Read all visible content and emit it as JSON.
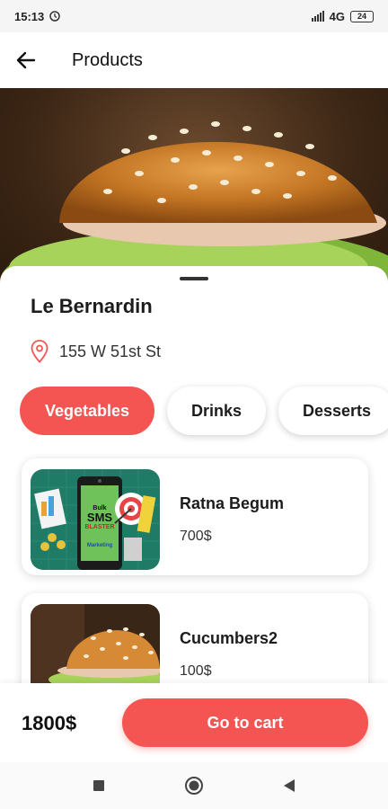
{
  "status_bar": {
    "time": "15:13",
    "network": "4G",
    "battery": "24"
  },
  "app_bar": {
    "title": "Products"
  },
  "restaurant": {
    "name": "Le Bernardin",
    "address": "155 W 51st St"
  },
  "categories": [
    {
      "label": "Vegetables",
      "active": true
    },
    {
      "label": "Drinks",
      "active": false
    },
    {
      "label": "Desserts",
      "active": false
    }
  ],
  "products": [
    {
      "name": "Ratna Begum",
      "price": "700$",
      "thumb_label_top": "Bulk",
      "thumb_label_mid": "SMS",
      "thumb_label_bot": "BLASTER",
      "thumb_label_foot": "Marketing"
    },
    {
      "name": "Cucumbers2",
      "price": "100$"
    }
  ],
  "cart": {
    "total": "1800$",
    "button_label": "Go to cart"
  },
  "colors": {
    "accent": "#f45552",
    "text": "#1c1c1c"
  },
  "icons": [
    "back-arrow-icon",
    "location-pin-icon",
    "square-nav-icon",
    "home-circle-nav-icon",
    "back-triangle-nav-icon"
  ]
}
